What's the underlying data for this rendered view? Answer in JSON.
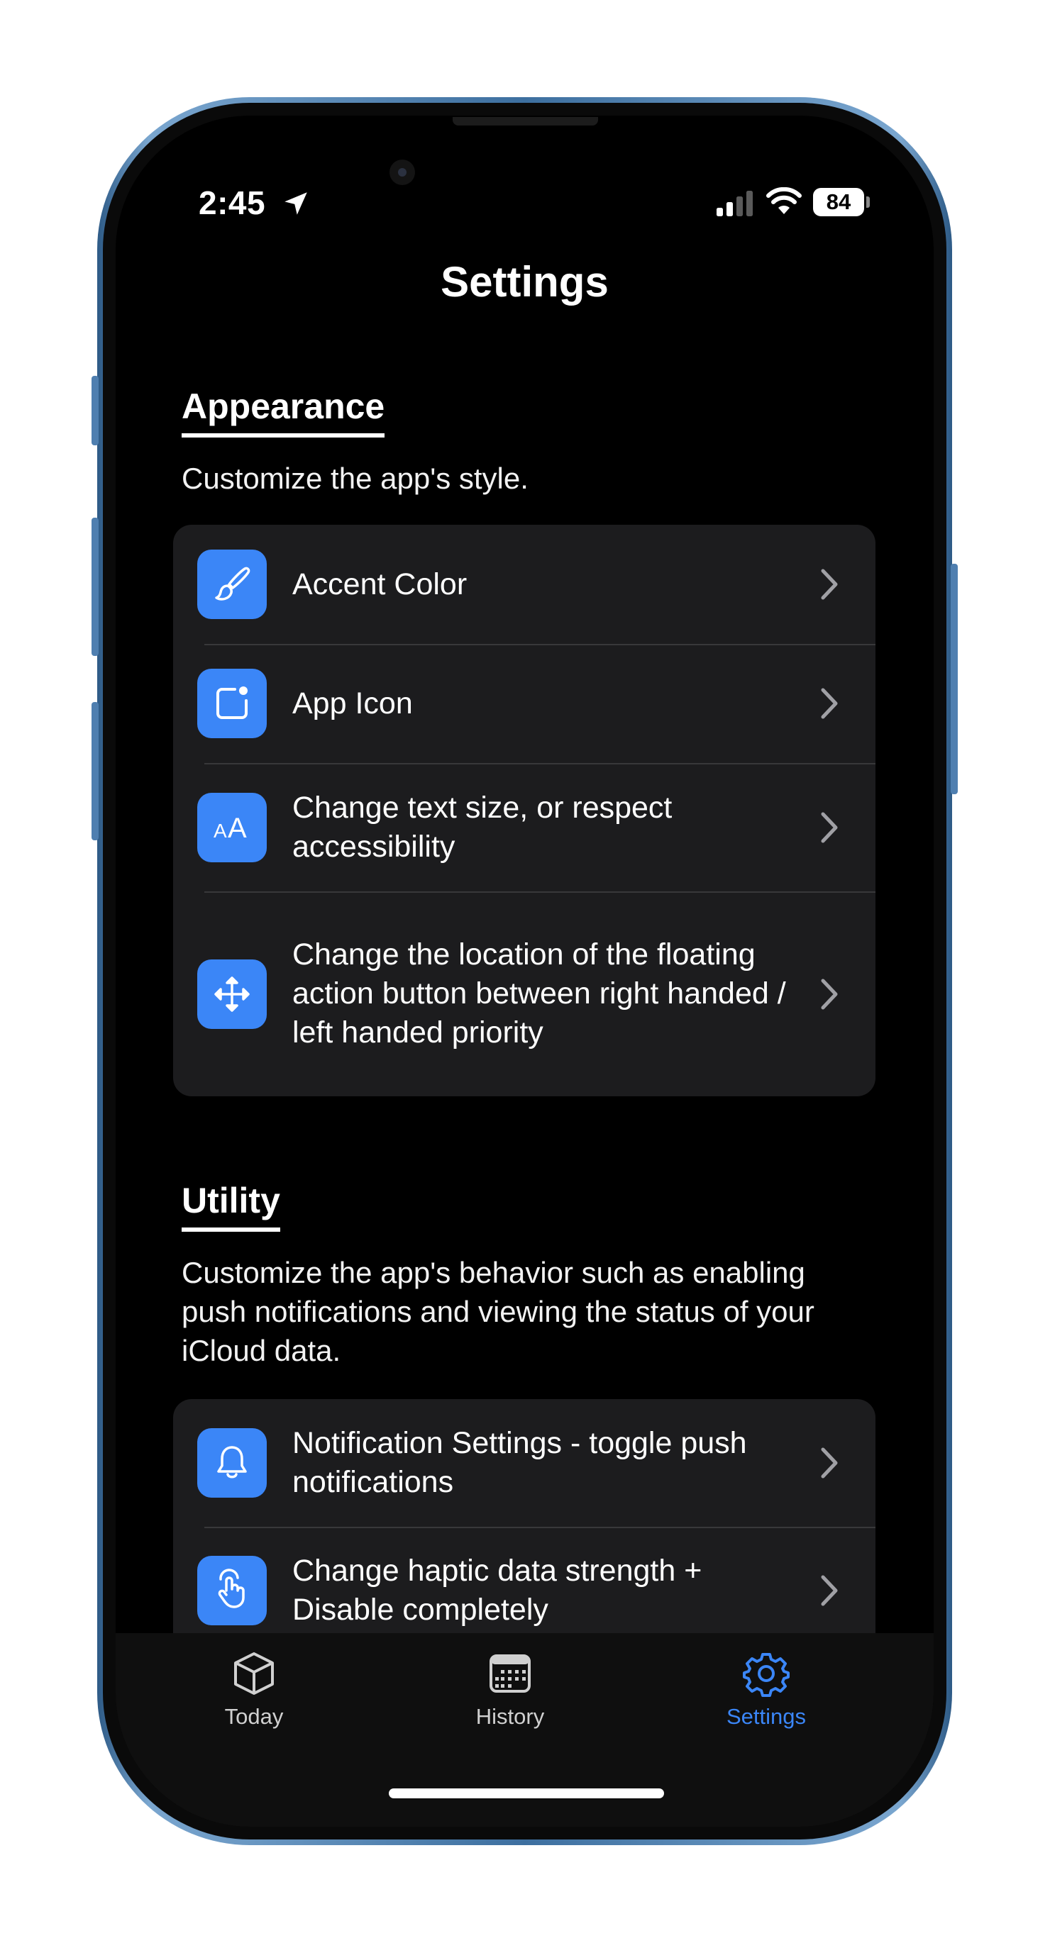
{
  "status_bar": {
    "time": "2:45",
    "battery": "84"
  },
  "nav": {
    "title": "Settings"
  },
  "sections": [
    {
      "title": "Appearance",
      "description": "Customize the app's style.",
      "items": [
        {
          "label": "Accent Color",
          "icon": "paintbrush-icon"
        },
        {
          "label": "App Icon",
          "icon": "app-icon-icon"
        },
        {
          "label": "Change text size, or respect accessibility",
          "icon": "text-size-icon"
        },
        {
          "label": "Change the location of the floating action button between right handed / left handed priority",
          "icon": "move-arrows-icon"
        }
      ]
    },
    {
      "title": "Utility",
      "description": "Customize the app's behavior such as enabling push notifications and viewing the status of your iCloud data.",
      "items": [
        {
          "label": "Notification Settings - toggle push notifications",
          "icon": "bell-icon"
        },
        {
          "label": "Change haptic data strength + Disable completely",
          "icon": "tap-hand-icon"
        }
      ]
    }
  ],
  "tabbar": {
    "tabs": [
      {
        "label": "Today",
        "icon": "cube-icon",
        "active": false
      },
      {
        "label": "History",
        "icon": "calendar-icon",
        "active": false
      },
      {
        "label": "Settings",
        "icon": "gear-icon",
        "active": true
      }
    ]
  },
  "colors": {
    "accent": "#3b86f7",
    "background": "#000000",
    "group": "#1c1c1e"
  }
}
